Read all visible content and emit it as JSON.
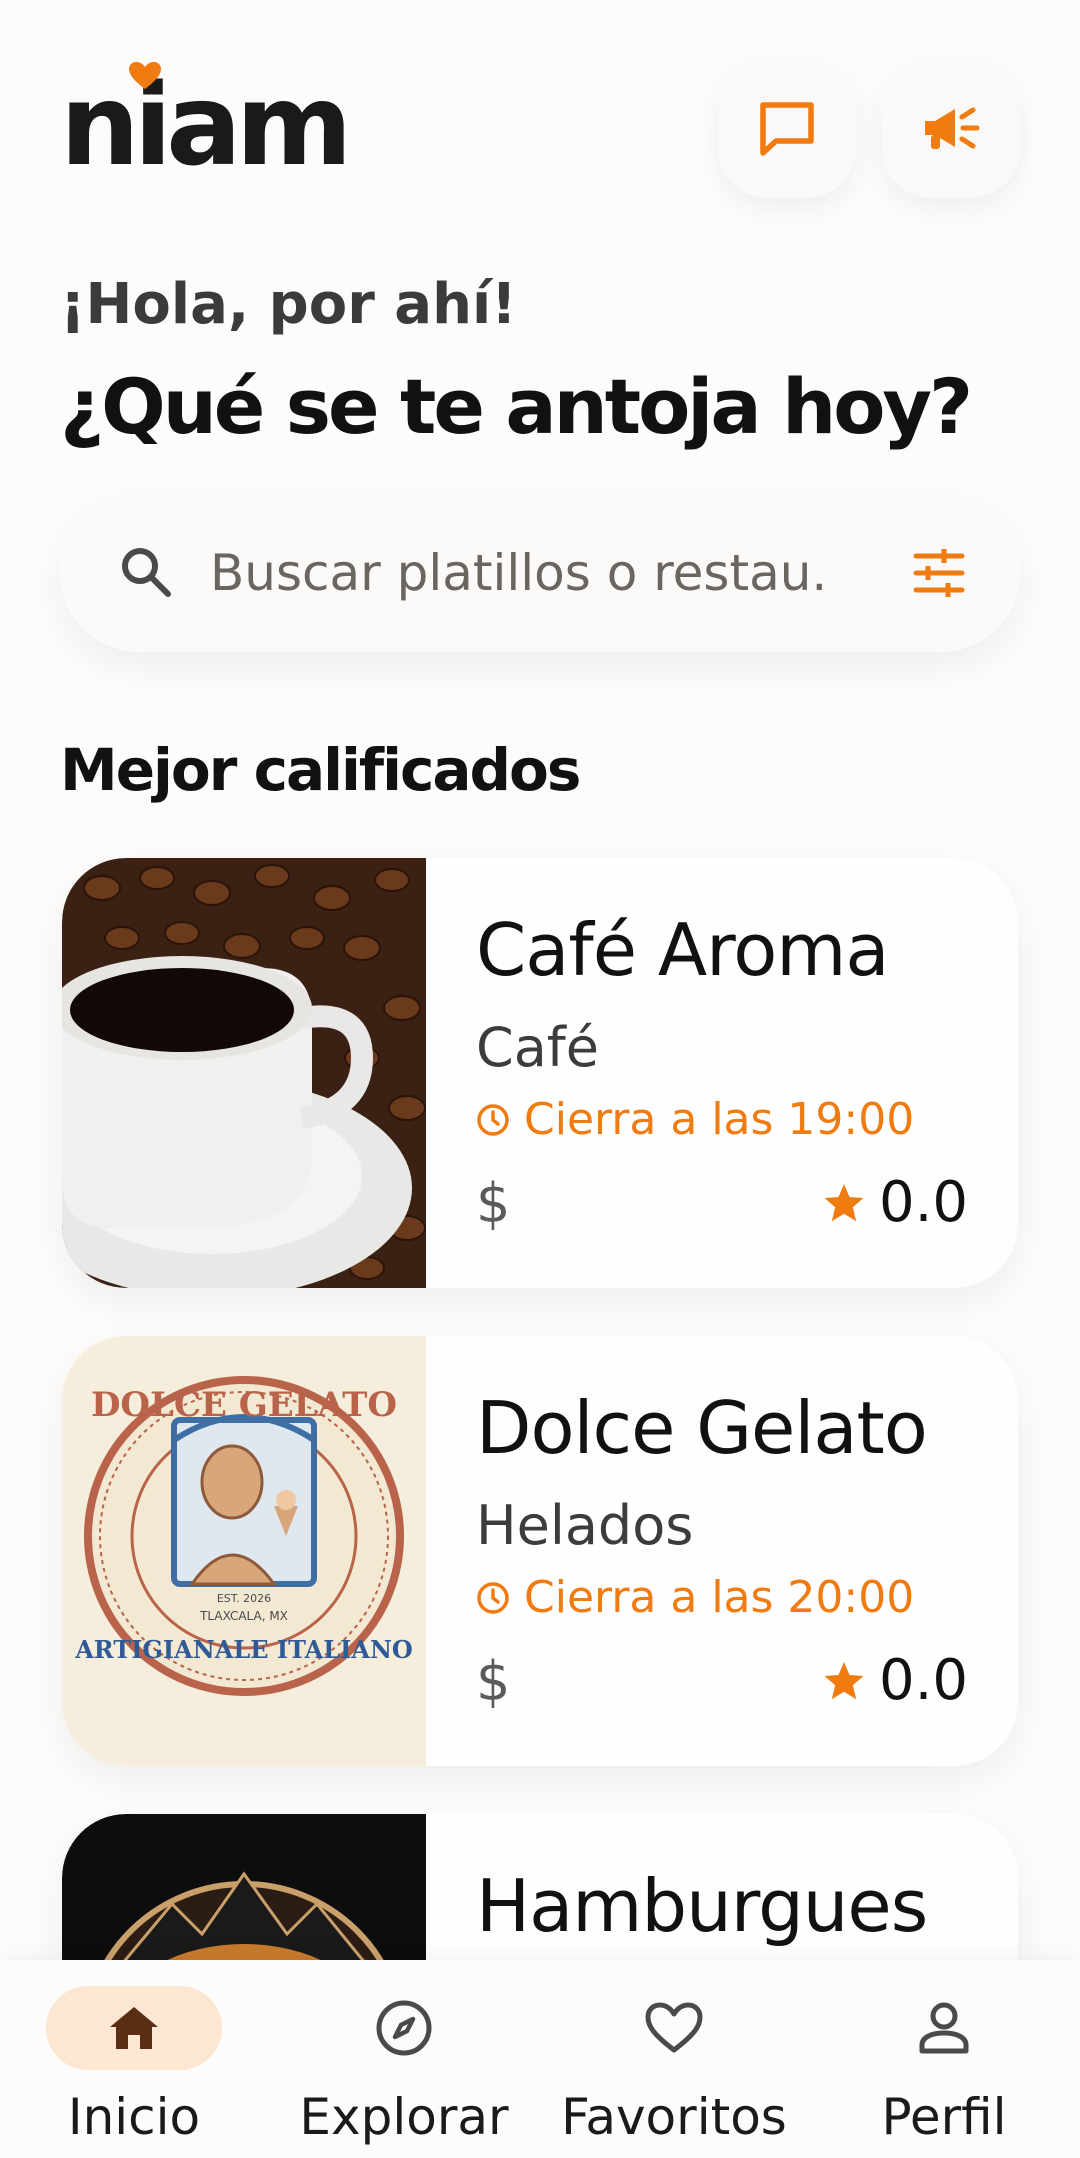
{
  "header": {
    "logo_text": "niam",
    "chat_icon": "chat-bubble-icon",
    "promo_icon": "megaphone-icon"
  },
  "greeting": "¡Hola, por ahí!",
  "headline": "¿Qué se te antoja hoy?",
  "search": {
    "placeholder": "Buscar platillos o restau...",
    "value": "",
    "search_icon": "search-icon",
    "filter_icon": "filter-sliders-icon"
  },
  "section": {
    "title": "Mejor calificados"
  },
  "restaurants": [
    {
      "name": "Café Aroma",
      "category": "Café",
      "hours": "Cierra a las 19:00",
      "price": "$",
      "rating": "0.0"
    },
    {
      "name": "Dolce Gelato",
      "category": "Helados",
      "hours": "Cierra a las 20:00",
      "price": "$",
      "rating": "0.0"
    },
    {
      "name": "Hamburgues",
      "category": "",
      "hours": "",
      "price": "",
      "rating": ""
    }
  ],
  "nav": [
    {
      "label": "Inicio",
      "icon": "home-icon"
    },
    {
      "label": "Explorar",
      "icon": "compass-icon"
    },
    {
      "label": "Favoritos",
      "icon": "heart-icon"
    },
    {
      "label": "Perfil",
      "icon": "user-icon"
    }
  ],
  "colors": {
    "accent": "#f07b10",
    "nav_active_bg": "#fde6d2",
    "text_dark": "#111111"
  },
  "logo_seal": {
    "top_text": "DOLCE GELATO",
    "bottom_text": "ARTIGIANALE ITALIANO",
    "est": "EST. 2026",
    "place": "TLAXCALA, MX"
  }
}
